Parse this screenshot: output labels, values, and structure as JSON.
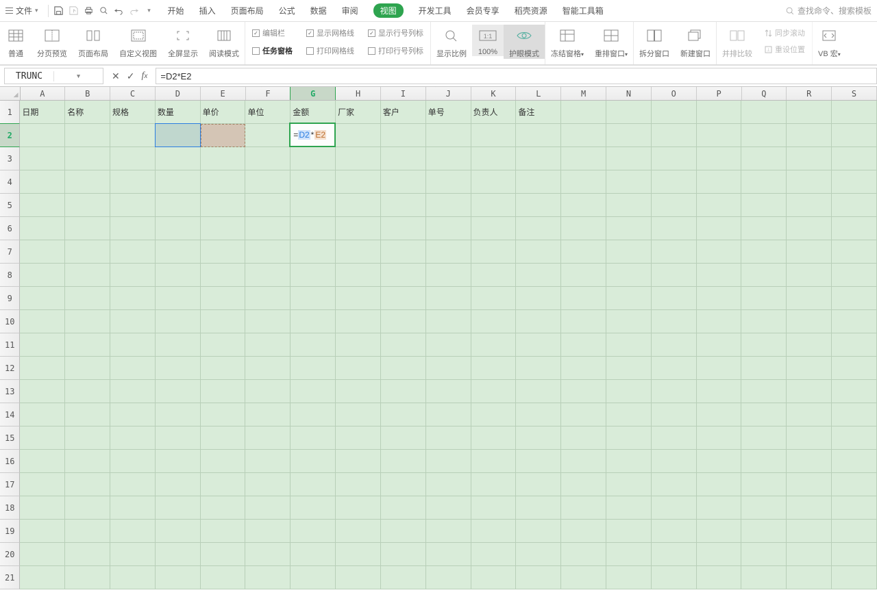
{
  "topmenu": {
    "file_label": "文件",
    "tabs": [
      "开始",
      "插入",
      "页面布局",
      "公式",
      "数据",
      "审阅",
      "视图",
      "开发工具",
      "会员专享",
      "稻壳资源",
      "智能工具箱"
    ],
    "active_index": 6,
    "search_placeholder": "查找命令、搜索模板"
  },
  "ribbon": {
    "view_group": [
      {
        "label": "普通"
      },
      {
        "label": "分页预览"
      },
      {
        "label": "页面布局"
      },
      {
        "label": "自定义视图"
      },
      {
        "label": "全屏显示"
      },
      {
        "label": "阅读模式"
      }
    ],
    "check_group1": [
      {
        "label": "编辑栏",
        "checked": true
      },
      {
        "label": "任务窗格",
        "checked": false
      }
    ],
    "check_group2": [
      {
        "label": "显示网格线",
        "checked": true
      },
      {
        "label": "打印网格线",
        "checked": false
      }
    ],
    "check_group3": [
      {
        "label": "显示行号列标",
        "checked": true
      },
      {
        "label": "打印行号列标",
        "checked": false
      }
    ],
    "zoom_group": [
      {
        "label": "显示比例"
      },
      {
        "label": "100%"
      },
      {
        "label": "护眼模式"
      }
    ],
    "window_group1": [
      {
        "label": "冻结窗格"
      },
      {
        "label": "重排窗口"
      }
    ],
    "window_group2": [
      {
        "label": "拆分窗口"
      },
      {
        "label": "新建窗口"
      }
    ],
    "window_group3": [
      {
        "label": "并排比较"
      },
      {
        "label": "同步滚动"
      },
      {
        "label": "重设位置"
      }
    ],
    "macro": {
      "label": "VB 宏"
    }
  },
  "formula_bar": {
    "name_box": "TRUNC",
    "formula": "=D2*E2"
  },
  "sheet": {
    "columns": [
      "A",
      "B",
      "C",
      "D",
      "E",
      "F",
      "G",
      "H",
      "I",
      "J",
      "K",
      "L",
      "M",
      "N",
      "O",
      "P",
      "Q",
      "R",
      "S"
    ],
    "active_col": "G",
    "active_row": 2,
    "row_count": 21,
    "headers": [
      "日期",
      "名称",
      "规格",
      "数量",
      "单价",
      "单位",
      "金额",
      "厂家",
      "客户",
      "单号",
      "负责人",
      "备注"
    ],
    "editing_cell": {
      "eq": "=",
      "ref1": "D2",
      "star": "*",
      "ref2": "E2"
    }
  }
}
